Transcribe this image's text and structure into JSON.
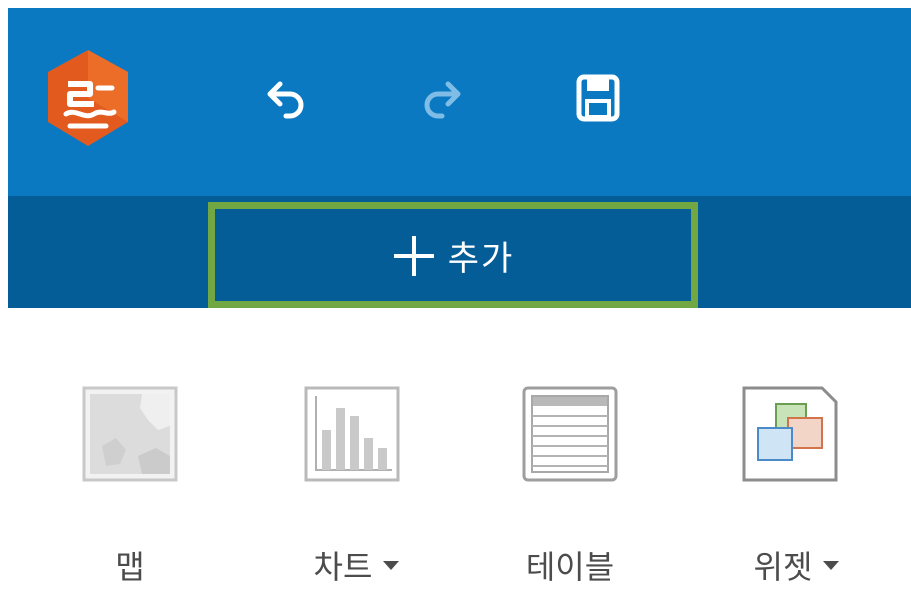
{
  "toolbar": {
    "undo_icon": "undo-icon",
    "redo_icon": "redo-icon",
    "save_icon": "save-icon"
  },
  "add_button": {
    "label": "추가",
    "icon": "plus-icon"
  },
  "gallery": [
    {
      "label": "맵",
      "icon": "map-thumbnail-icon",
      "has_dropdown": false
    },
    {
      "label": "차트",
      "icon": "bar-chart-thumbnail-icon",
      "has_dropdown": true
    },
    {
      "label": "테이블",
      "icon": "table-thumbnail-icon",
      "has_dropdown": false
    },
    {
      "label": "위젯",
      "icon": "widget-thumbnail-icon",
      "has_dropdown": true
    }
  ],
  "colors": {
    "header": "#0a79c2",
    "subbar": "#045d97",
    "highlight": "#71a844",
    "logo": "#e35a1f"
  }
}
